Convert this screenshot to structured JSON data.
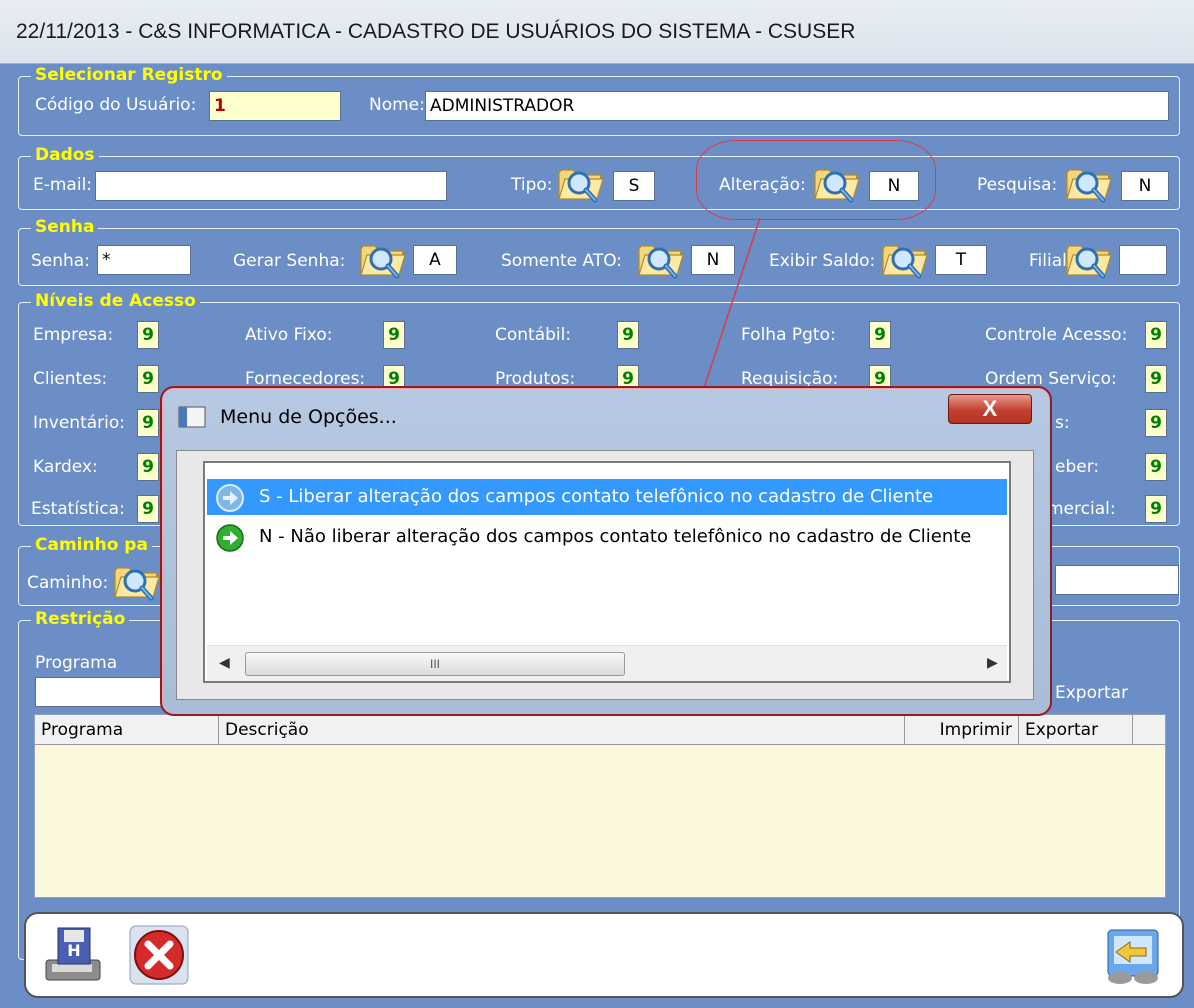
{
  "title": "22/11/2013  -  C&S INFORMATICA  -  CADASTRO DE USUÁRIOS DO SISTEMA  -  CSUSER",
  "selecionar": {
    "title": "Selecionar Registro",
    "codigo_label": "Código do Usuário:",
    "codigo_value": "1",
    "nome_label": "Nome:",
    "nome_value": "ADMINISTRADOR"
  },
  "dados": {
    "title": "Dados",
    "email_label": "E-mail:",
    "email_value": "",
    "tipo_label": "Tipo:",
    "tipo_value": "S",
    "alteracao_label": "Alteração:",
    "alteracao_value": "N",
    "pesquisa_label": "Pesquisa:",
    "pesquisa_value": "N"
  },
  "senha": {
    "title": "Senha",
    "senha_label": "Senha:",
    "senha_value": "*",
    "gerar_label": "Gerar Senha:",
    "gerar_value": "A",
    "somente_label": "Somente ATO:",
    "somente_value": "N",
    "exibir_label": "Exibir Saldo:",
    "exibir_value": "T",
    "filial_label": "Filial:",
    "filial_value": ""
  },
  "niveis": {
    "title": "Níveis de Acesso",
    "row1": [
      {
        "label": "Empresa:",
        "value": "9"
      },
      {
        "label": "Ativo Fixo:",
        "value": "9"
      },
      {
        "label": "Contábil:",
        "value": "9"
      },
      {
        "label": "Folha Pgto:",
        "value": "9"
      },
      {
        "label": "Controle Acesso:",
        "value": "9"
      }
    ],
    "row2": [
      {
        "label": "Clientes:",
        "value": "9"
      },
      {
        "label": "Fornecedores:",
        "value": "9"
      },
      {
        "label": "Produtos:",
        "value": "9"
      },
      {
        "label": "Requisição:",
        "value": "9"
      },
      {
        "label": "Ordem Serviço:",
        "value": "9"
      }
    ],
    "row3": [
      {
        "label": "Inventário:",
        "value": "9"
      },
      {
        "label": "s:",
        "value": "9"
      }
    ],
    "row4": [
      {
        "label": "Kardex:",
        "value": "9"
      },
      {
        "label": "eber:",
        "value": "9"
      }
    ],
    "row5": [
      {
        "label": "Estatística:",
        "value": "9"
      },
      {
        "label": "mercial:",
        "value": "9"
      }
    ]
  },
  "caminho": {
    "title": "Caminho pa",
    "caminho_label": "Caminho:"
  },
  "restricao": {
    "title": "Restrição",
    "programa_label": "Programa",
    "exportar_label": "Exportar",
    "columns": [
      "Programa",
      "Descrição",
      "Imprimir",
      "Exportar"
    ]
  },
  "dialog": {
    "title": "Menu de Opções...",
    "close_label": "X",
    "options": [
      "S - Liberar alteração dos campos contato telefônico no cadastro de Cliente",
      "N - Não liberar alteração dos campos contato telefônico no cadastro de Cliente"
    ],
    "scroll_grip": "III"
  },
  "colors": {
    "background": "#6c8ec6",
    "group_title": "#ffff00",
    "selection": "#3399ff",
    "level_value": "#008000"
  }
}
